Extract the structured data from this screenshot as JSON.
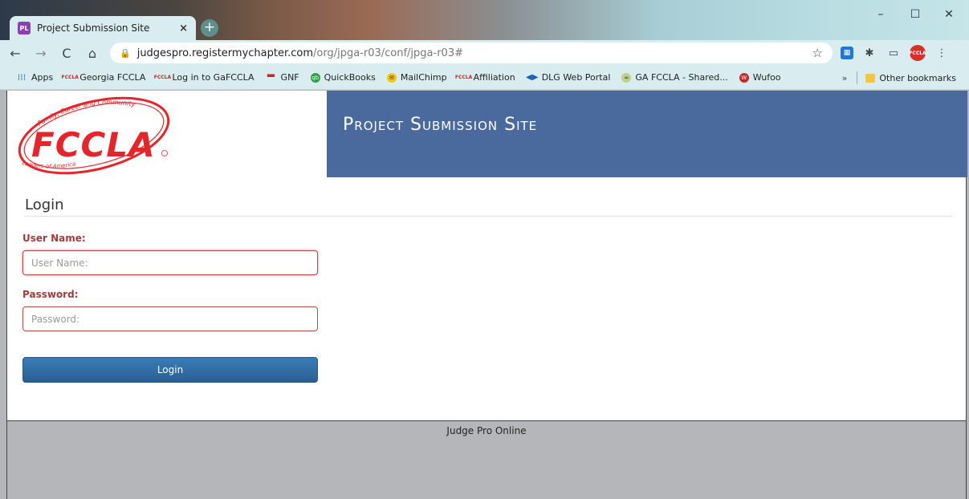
{
  "browser": {
    "tab_title": "Project Submission Site",
    "tab_favicon": "PL",
    "tab_close": "×",
    "new_tab": "+",
    "window": {
      "minimize": "–",
      "maximize": "☐",
      "close": "✕"
    },
    "nav": {
      "back": "←",
      "forward": "→",
      "reload": "C",
      "home": "⌂"
    },
    "url_host": "judgespro.registermychapter.com",
    "url_path": "/org/jpga-r03/conf/jpga-r03#",
    "bookmarks": [
      {
        "label": "Apps",
        "icon": "apps-grid-icon"
      },
      {
        "label": "Georgia FCCLA",
        "icon": "fccla-icon"
      },
      {
        "label": "Log in to GaFCCLA",
        "icon": "fccla-icon"
      },
      {
        "label": "GNF",
        "icon": "calendar-icon"
      },
      {
        "label": "QuickBooks",
        "icon": "quickbooks-icon"
      },
      {
        "label": "MailChimp",
        "icon": "mailchimp-icon"
      },
      {
        "label": "Affiliation",
        "icon": "fccla-icon"
      },
      {
        "label": "DLG Web Portal",
        "icon": "dlg-icon"
      },
      {
        "label": "GA FCCLA - Shared...",
        "icon": "drive-icon"
      },
      {
        "label": "Wufoo",
        "icon": "wufoo-icon"
      }
    ],
    "bookmarks_more": "»",
    "other_bookmarks": "Other bookmarks"
  },
  "header": {
    "logo_text": "FCCLA",
    "logo_arc_top": "Family, Career and Community",
    "logo_arc_bottom": "Leaders of America",
    "title": "Project Submission Site"
  },
  "login": {
    "heading": "Login",
    "username_label": "User Name:",
    "username_placeholder": "User Name:",
    "password_label": "Password:",
    "password_placeholder": "Password:",
    "button_label": "Login"
  },
  "footer": {
    "text": "Judge Pro Online"
  },
  "colors": {
    "header_band": "#4a6a9d",
    "label_red": "#a23b3b",
    "button_blue": "#2a5f92",
    "logo_red": "#e3262b"
  }
}
